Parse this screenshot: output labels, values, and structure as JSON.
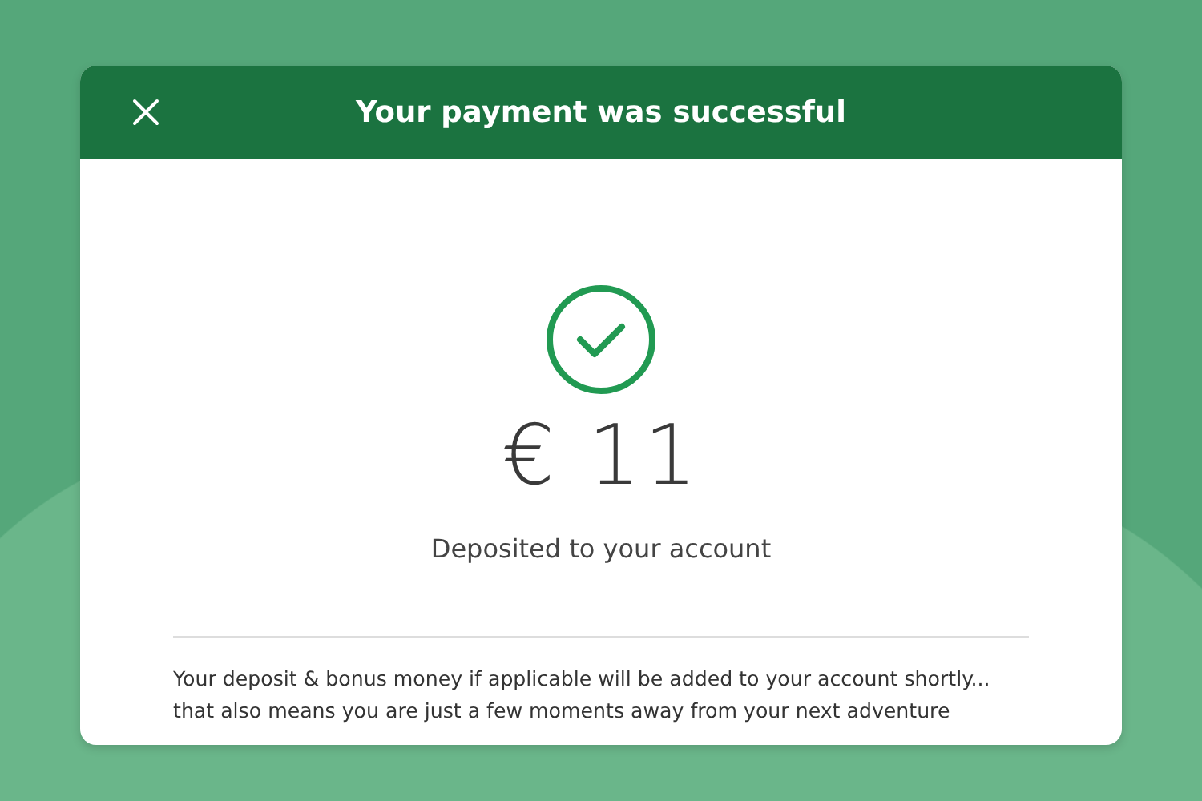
{
  "dialog": {
    "title": "Your payment was successful",
    "amount": "€ 11",
    "caption": "Deposited to your account",
    "message": "Your deposit & bonus money if applicable will be added to your account shortly... that also means you are just a few moments away from your next adventure"
  }
}
